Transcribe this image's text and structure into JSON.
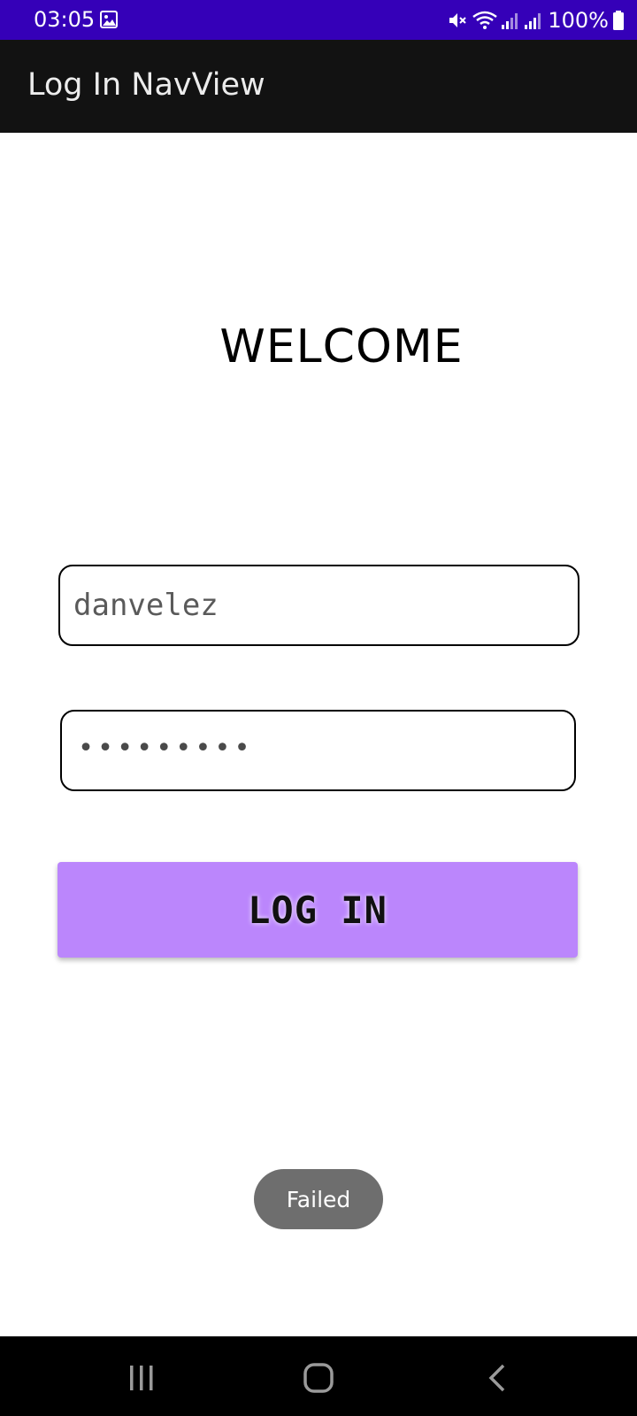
{
  "status_bar": {
    "time": "03:05",
    "battery": "100%",
    "icons": [
      "image-icon",
      "mute-icon",
      "wifi-icon",
      "signal-icon",
      "signal-icon",
      "battery-icon"
    ],
    "background": "#3500b8"
  },
  "app_bar": {
    "title": "Log In NavView",
    "background": "#121212"
  },
  "login": {
    "heading": "WELCOME",
    "username_value": "danvelez",
    "password_mask": "•••••••••",
    "button_label": "LOG IN",
    "button_color": "#bb86fc"
  },
  "toast": {
    "message": "Failed"
  },
  "nav_bar": {
    "icons": [
      "recent-apps-icon",
      "home-icon",
      "back-icon"
    ]
  }
}
